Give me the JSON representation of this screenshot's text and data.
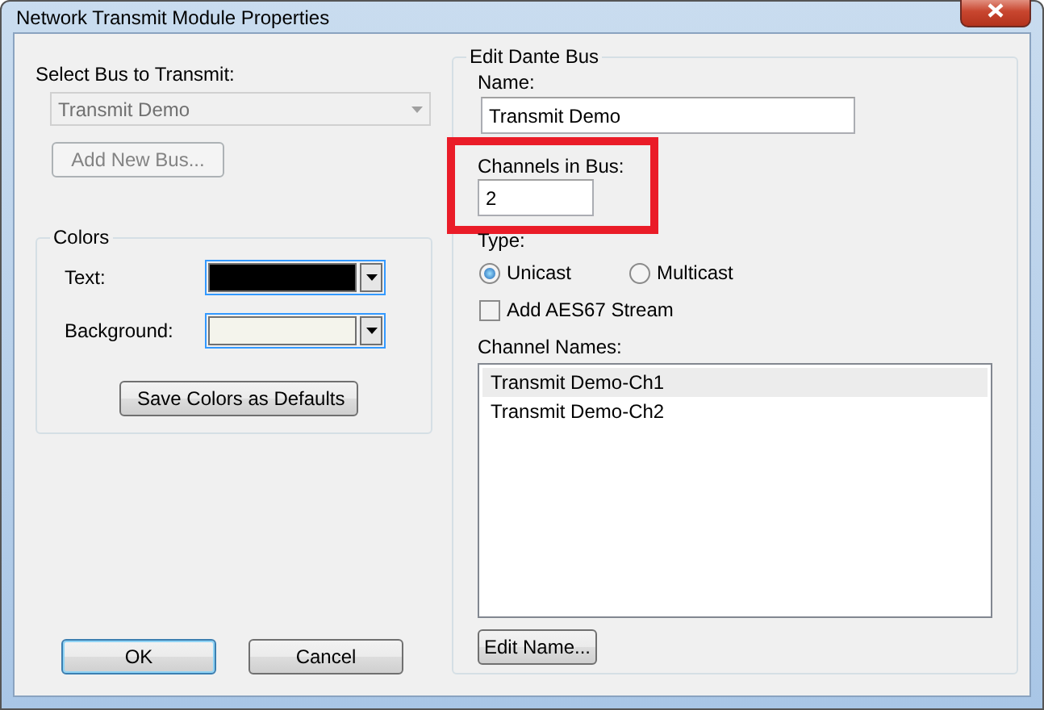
{
  "window": {
    "title": "Network Transmit Module Properties"
  },
  "select_bus": {
    "label": "Select Bus to Transmit:",
    "value": "Transmit Demo",
    "disabled": true
  },
  "add_bus_button": {
    "label": "Add New Bus...",
    "disabled": true
  },
  "colors": {
    "title": "Colors",
    "rows": [
      {
        "label": "Text:",
        "color": "#000000"
      },
      {
        "label": "Background:",
        "color": "#f4f4ec"
      }
    ],
    "save_button": "Save Colors as Defaults"
  },
  "dialog_buttons": [
    {
      "label": "OK",
      "default": true
    },
    {
      "label": "Cancel",
      "default": false
    }
  ],
  "edit_bus": {
    "title": "Edit Dante Bus",
    "name": {
      "label": "Name:",
      "value": "Transmit Demo"
    },
    "channels": {
      "label": "Channels in Bus:",
      "value": "2",
      "highlighted": true
    },
    "type": {
      "label": "Type:",
      "options": [
        {
          "label": "Unicast",
          "selected": true
        },
        {
          "label": "Multicast",
          "selected": false
        }
      ]
    },
    "aes67": {
      "label": "Add AES67 Stream",
      "checked": false
    },
    "channel_names": {
      "label": "Channel Names:",
      "items": [
        {
          "label": "Transmit Demo-Ch1",
          "selected": true
        },
        {
          "label": "Transmit Demo-Ch2",
          "selected": false
        }
      ]
    },
    "edit_name_button": "Edit Name..."
  }
}
